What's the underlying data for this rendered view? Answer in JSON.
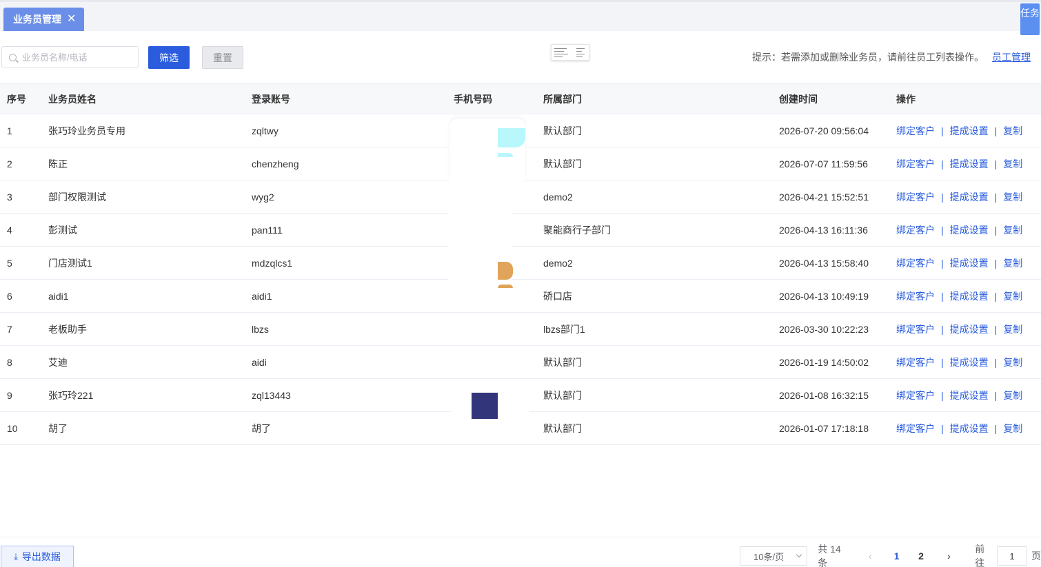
{
  "tabbar": {
    "active_tab": "业务员管理",
    "close_glyph": "✕",
    "task_button": "任务"
  },
  "filter": {
    "search_placeholder": "业务员名称/电话",
    "search_value": "",
    "filter_button": "筛选",
    "reset_button": "重置",
    "hint_text": "提示：若需添加或删除业务员，请前往员工列表操作。",
    "hint_link": "员工管理"
  },
  "table": {
    "headers": [
      "序号",
      "业务员姓名",
      "登录账号",
      "手机号码",
      "所属部门",
      "创建时间",
      "操作"
    ],
    "rows": [
      {
        "no": "1",
        "name": "张巧玲业务员专用",
        "account": "zqltwy",
        "phone": "",
        "dept": "默认部门",
        "created": "2026-07-20 09:56:04"
      },
      {
        "no": "2",
        "name": "陈正",
        "account": "chenzheng",
        "phone": "",
        "dept": "默认部门",
        "created": "2026-07-07 11:59:56"
      },
      {
        "no": "3",
        "name": "部门权限测试",
        "account": "wyg2",
        "phone": "",
        "dept": "demo2",
        "created": "2026-04-21 15:52:51"
      },
      {
        "no": "4",
        "name": "彭测试",
        "account": "pan111",
        "phone": "",
        "dept": "聚能商行子部门",
        "created": "2026-04-13 16:11:36"
      },
      {
        "no": "5",
        "name": "门店测试1",
        "account": "mdzqlcs1",
        "phone": "",
        "dept": "demo2",
        "created": "2026-04-13 15:58:40"
      },
      {
        "no": "6",
        "name": "aidi1",
        "account": "aidi1",
        "phone": "",
        "dept": "硚口店",
        "created": "2026-04-13 10:49:19"
      },
      {
        "no": "7",
        "name": "老板助手",
        "account": "lbzs",
        "phone": "",
        "dept": "lbzs部门1",
        "created": "2026-03-30 10:22:23"
      },
      {
        "no": "8",
        "name": "艾迪",
        "account": "aidi",
        "phone": "",
        "dept": "默认部门",
        "created": "2026-01-19 14:50:02"
      },
      {
        "no": "9",
        "name": "张巧玲221",
        "account": "zql13443",
        "phone": "",
        "dept": "默认部门",
        "created": "2026-01-08 16:32:15"
      },
      {
        "no": "10",
        "name": "胡了",
        "account": "胡了",
        "phone": "",
        "dept": "默认部门",
        "created": "2026-01-07 17:18:18"
      }
    ],
    "actions": [
      "绑定客户",
      "提成设置",
      "复制"
    ],
    "action_separator": "|"
  },
  "footer": {
    "export_button": "导出数据",
    "page_size": "10条/页",
    "total": "共 14 条",
    "pages": [
      "1",
      "2"
    ],
    "current_page": "1",
    "goto_prefix": "前往",
    "goto_value": "1",
    "goto_suffix": "页"
  },
  "colors": {
    "accent": "#2a5cdd",
    "tab_bg": "#6b8fe8",
    "task_btn": "#5b8ff0"
  },
  "icons": [
    "close-icon",
    "search-icon",
    "download-icon",
    "chevron-down-icon",
    "chevron-left-icon",
    "chevron-right-icon"
  ]
}
